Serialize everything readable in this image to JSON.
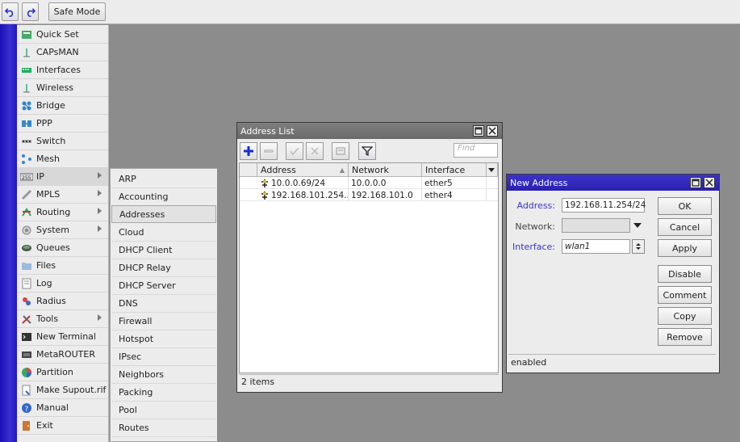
{
  "toolbar": {
    "safe_mode": "Safe Mode"
  },
  "menu": [
    {
      "label": "Quick Set",
      "icon": "quick-set-icon"
    },
    {
      "label": "CAPsMAN",
      "icon": "capsman-icon"
    },
    {
      "label": "Interfaces",
      "icon": "interfaces-icon"
    },
    {
      "label": "Wireless",
      "icon": "wireless-icon"
    },
    {
      "label": "Bridge",
      "icon": "bridge-icon"
    },
    {
      "label": "PPP",
      "icon": "ppp-icon"
    },
    {
      "label": "Switch",
      "icon": "switch-icon"
    },
    {
      "label": "Mesh",
      "icon": "mesh-icon"
    },
    {
      "label": "IP",
      "icon": "ip-icon",
      "submenu": true,
      "selected": true
    },
    {
      "label": "MPLS",
      "icon": "mpls-icon",
      "submenu": true
    },
    {
      "label": "Routing",
      "icon": "routing-icon",
      "submenu": true
    },
    {
      "label": "System",
      "icon": "system-icon",
      "submenu": true
    },
    {
      "label": "Queues",
      "icon": "queues-icon"
    },
    {
      "label": "Files",
      "icon": "files-icon"
    },
    {
      "label": "Log",
      "icon": "log-icon"
    },
    {
      "label": "Radius",
      "icon": "radius-icon"
    },
    {
      "label": "Tools",
      "icon": "tools-icon",
      "submenu": true
    },
    {
      "label": "New Terminal",
      "icon": "terminal-icon"
    },
    {
      "label": "MetaROUTER",
      "icon": "metarouter-icon"
    },
    {
      "label": "Partition",
      "icon": "partition-icon"
    },
    {
      "label": "Make Supout.rif",
      "icon": "supout-icon"
    },
    {
      "label": "Manual",
      "icon": "manual-icon"
    },
    {
      "label": "Exit",
      "icon": "exit-icon"
    }
  ],
  "ip_submenu": [
    "ARP",
    "Accounting",
    "Addresses",
    "Cloud",
    "DHCP Client",
    "DHCP Relay",
    "DHCP Server",
    "DNS",
    "Firewall",
    "Hotspot",
    "IPsec",
    "Neighbors",
    "Packing",
    "Pool",
    "Routes"
  ],
  "ip_submenu_selected": "Addresses",
  "address_list": {
    "title": "Address List",
    "find_placeholder": "Find",
    "columns": [
      "Address",
      "Network",
      "Interface"
    ],
    "rows": [
      {
        "address": "10.0.0.69/24",
        "network": "10.0.0.0",
        "interface": "ether5"
      },
      {
        "address": "192.168.101.254...",
        "network": "192.168.101.0",
        "interface": "ether4"
      }
    ],
    "status": "2 items"
  },
  "new_address": {
    "title": "New Address",
    "address_label": "Address:",
    "address_value": "192.168.11.254/24",
    "network_label": "Network:",
    "network_value": "",
    "interface_label": "Interface:",
    "interface_value": "wlan1",
    "buttons": [
      "OK",
      "Cancel",
      "Apply",
      "Disable",
      "Comment",
      "Copy",
      "Remove"
    ],
    "status": "enabled"
  },
  "colors": {
    "accent": "#3a35c8",
    "strip": "#2016c0",
    "add_icon": "#1a2bd0"
  }
}
